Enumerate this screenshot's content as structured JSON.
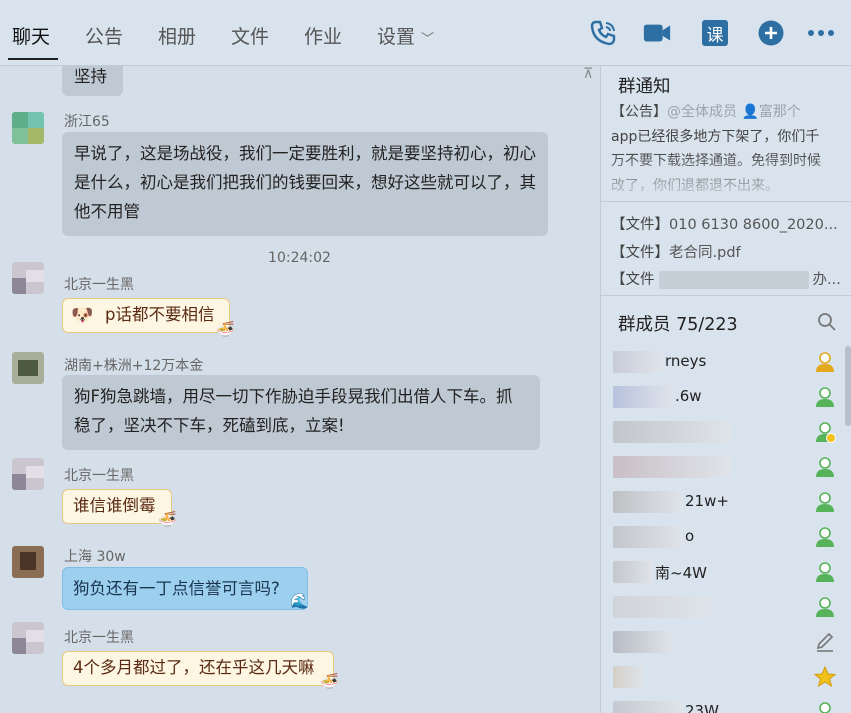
{
  "tabs": [
    {
      "label": "聊天"
    },
    {
      "label": "公告"
    },
    {
      "label": "相册"
    },
    {
      "label": "文件"
    },
    {
      "label": "作业"
    },
    {
      "label": "设置"
    }
  ],
  "toolbar_icons": [
    "phone-icon",
    "video-call-icon",
    "class-icon",
    "add-icon",
    "more-icon"
  ],
  "toolbar": {
    "class_label": "课"
  },
  "colors": {
    "accent": "#2d6fa3",
    "bubble": "#bfc9d3",
    "cream_bubble": "#fdf6e3",
    "blue_bubble": "#9cd0ee"
  },
  "chat": {
    "messages": [
      {
        "sender": "",
        "text": "坚持"
      },
      {
        "sender": "浙江65",
        "text": "早说了，这是场战役，我们一定要胜利，就是要坚持初心，初心是什么，初心是我们把我们的钱要回来，想好这些就可以了，其他不用管"
      },
      {
        "timestamp": "10:24:02"
      },
      {
        "sender": "北京一生黑",
        "text": "p话都不要相信"
      },
      {
        "sender": "湖南+株洲+12万本金",
        "text": "狗F狗急跳墙，用尽一切下作胁迫手段晃我们出借人下车。抓稳了，坚决不下车，死磕到底，立案!"
      },
      {
        "sender": "北京一生黑",
        "text": "谁信谁倒霉"
      },
      {
        "sender": "上海   30w",
        "text": "狗负还有一丁点信誉可言吗?"
      },
      {
        "sender": "北京一生黑",
        "text": "4个多月都过了，还在乎这几天嘛"
      }
    ]
  },
  "sidebar": {
    "notice_title": "群通知",
    "notice": {
      "prefix": "【公告】",
      "mention": "@全体成员",
      "mention_name": "富那个",
      "body": "app已经很多地方下架了，你们千万不要下载选择通道。免得到时候改了，你们退都退不出来。"
    },
    "files": [
      {
        "prefix": "【文件】",
        "name": "010 6130 8600_2020..."
      },
      {
        "prefix": "【文件】",
        "name": "老合同.pdf"
      },
      {
        "prefix": "【文件",
        "name": "办..."
      }
    ],
    "members_title": "群成员 75/223",
    "members": [
      {
        "name_suffix": "rneys",
        "role": "owner"
      },
      {
        "name_suffix": ".6w",
        "role": "member"
      },
      {
        "name_suffix": "",
        "role": "admin"
      },
      {
        "name_suffix": "",
        "role": "member"
      },
      {
        "name_suffix": "21w+",
        "role": "member"
      },
      {
        "name_suffix": "o",
        "role": "member"
      },
      {
        "name_suffix": "南~4W",
        "role": "member"
      },
      {
        "name_suffix": "",
        "role": "member"
      },
      {
        "name_suffix": "",
        "role": "edit"
      },
      {
        "name_suffix": "",
        "role": "star"
      },
      {
        "name_suffix": "23W",
        "role": "member"
      }
    ]
  }
}
